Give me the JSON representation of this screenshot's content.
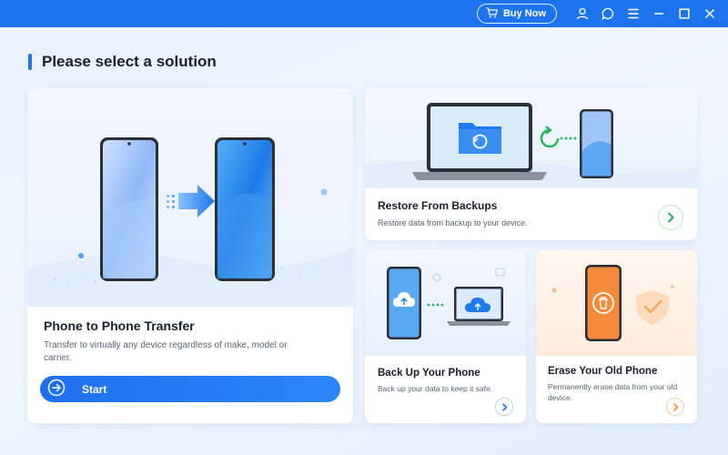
{
  "titlebar": {
    "buy_label": "Buy Now",
    "accent": "#1e74ee",
    "icons": [
      "cart-icon",
      "user-icon",
      "chat-icon",
      "menu-icon",
      "minimize-icon",
      "maximize-icon",
      "close-icon"
    ]
  },
  "heading": "Please select a solution",
  "cards": {
    "p2p": {
      "title": "Phone to Phone Transfer",
      "desc": "Transfer to virtually any device regardless of make, model or carrier.",
      "button": "Start"
    },
    "restore": {
      "title": "Restore From Backups",
      "desc": "Restore data from backup to your device."
    },
    "backup": {
      "title": "Back Up Your Phone",
      "desc": "Back up your data to keep it safe."
    },
    "erase": {
      "title": "Erase Your Old Phone",
      "desc": "Permanently erase data from your old device."
    }
  }
}
